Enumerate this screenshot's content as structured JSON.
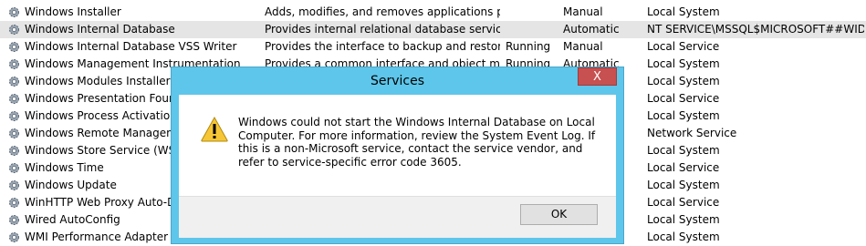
{
  "services": [
    {
      "name": "Windows Installer",
      "description": "Adds, modifies, and removes applications pro...",
      "status": "",
      "startup": "Manual",
      "logon": "Local System"
    },
    {
      "name": "Windows Internal Database",
      "description": "Provides internal relational database services f...",
      "status": "",
      "startup": "Automatic",
      "logon": "NT SERVICE\\MSSQL$MICROSOFT##WID",
      "selected": true
    },
    {
      "name": "Windows Internal Database VSS Writer",
      "description": "Provides the interface to backup and restore ...",
      "status": "Running",
      "startup": "Manual",
      "logon": "Local Service"
    },
    {
      "name": "Windows Management Instrumentation",
      "description": "Provides a common interface and object mod...",
      "status": "Running",
      "startup": "Automatic",
      "logon": "Local System"
    },
    {
      "name": "Windows Modules Installer",
      "description": "",
      "status": "",
      "startup": "",
      "logon": "Local System"
    },
    {
      "name": "Windows Presentation Foundation",
      "description": "",
      "status": "",
      "startup": "",
      "logon": "Local Service"
    },
    {
      "name": "Windows Process Activation Service",
      "description": "",
      "status": "",
      "startup": "",
      "logon": "Local System"
    },
    {
      "name": "Windows Remote Management",
      "description": "",
      "status": "",
      "startup": "",
      "logon": "Network Service"
    },
    {
      "name": "Windows Store Service (WSService)",
      "description": "",
      "status": "",
      "startup": "",
      "logon": "Local System"
    },
    {
      "name": "Windows Time",
      "description": "",
      "status": "",
      "startup": "",
      "logon": "Local Service"
    },
    {
      "name": "Windows Update",
      "description": "",
      "status": "",
      "startup": "",
      "logon": "Local System"
    },
    {
      "name": "WinHTTP Web Proxy Auto-Discovery",
      "description": "",
      "status": "",
      "startup": "",
      "logon": "Local Service"
    },
    {
      "name": "Wired AutoConfig",
      "description": "",
      "status": "",
      "startup": "",
      "logon": "Local System"
    },
    {
      "name": "WMI Performance Adapter",
      "description": "",
      "status": "",
      "startup": "",
      "logon": "Local System"
    }
  ],
  "dialog": {
    "title": "Services",
    "close_label": "X",
    "message": "Windows could not start the Windows Internal Database on Local Computer. For more information, review the System Event Log. If this is a non-Microsoft service, contact the service vendor, and refer to service-specific error code 3605.",
    "ok_label": "OK",
    "icon": "warning-icon"
  },
  "colors": {
    "dialog_frame": "#5ec6ea",
    "close_button": "#c75050",
    "selected_row": "#e5e5e5"
  }
}
